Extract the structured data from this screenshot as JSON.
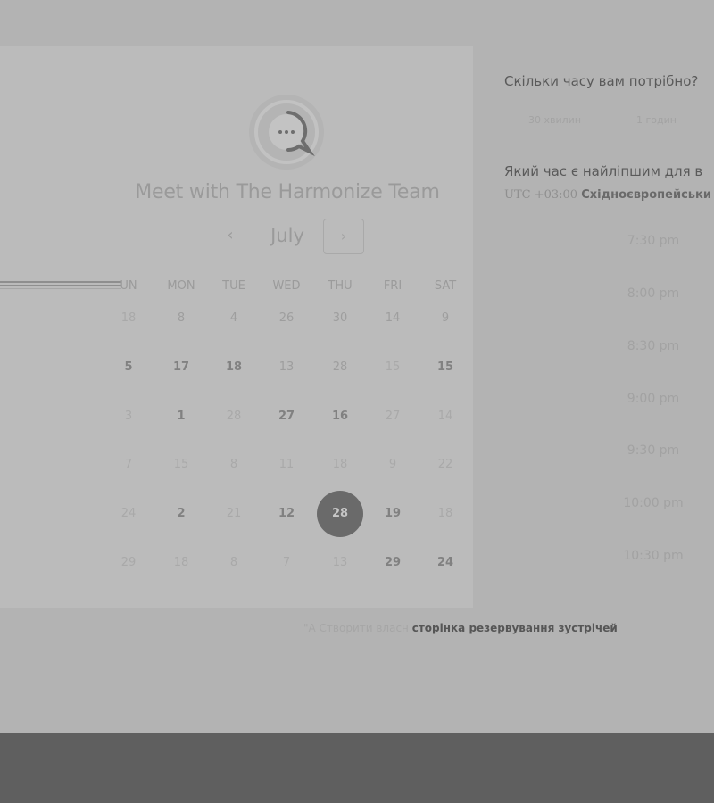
{
  "card": {
    "title": "Meet with The Harmonize Team",
    "month": "July",
    "prev_icon": "‹",
    "next_icon": "›",
    "logo_icon": "chat-bubble-icon",
    "weekdays": [
      "UN",
      "MON",
      "TUE",
      "WED",
      "THU",
      "FRI",
      "SAT"
    ],
    "rows": [
      [
        {
          "v": "18",
          "s": "faint"
        },
        {
          "v": "8",
          "s": "dim"
        },
        {
          "v": "4",
          "s": "dim"
        },
        {
          "v": "26",
          "s": "dim"
        },
        {
          "v": "30",
          "s": "dim"
        },
        {
          "v": "14",
          "s": "dim"
        },
        {
          "v": "9",
          "s": "dim"
        }
      ],
      [
        {
          "v": "5",
          "s": "bold"
        },
        {
          "v": "17",
          "s": "bold"
        },
        {
          "v": "18",
          "s": "bold"
        },
        {
          "v": "13",
          "s": "dim"
        },
        {
          "v": "28",
          "s": "dim"
        },
        {
          "v": "15",
          "s": "faint"
        },
        {
          "v": "15",
          "s": "bold"
        }
      ],
      [
        {
          "v": "3",
          "s": "faint"
        },
        {
          "v": "1",
          "s": "bold"
        },
        {
          "v": "28",
          "s": "faint"
        },
        {
          "v": "27",
          "s": "bold"
        },
        {
          "v": "16",
          "s": "bold"
        },
        {
          "v": "27",
          "s": "faint"
        },
        {
          "v": "14",
          "s": "faint"
        }
      ],
      [
        {
          "v": "7",
          "s": "faint"
        },
        {
          "v": "15",
          "s": "faint"
        },
        {
          "v": "8",
          "s": "faint"
        },
        {
          "v": "11",
          "s": "faint"
        },
        {
          "v": "18",
          "s": "faint"
        },
        {
          "v": "9",
          "s": "faint"
        },
        {
          "v": "22",
          "s": "faint"
        }
      ],
      [
        {
          "v": "24",
          "s": "faint"
        },
        {
          "v": "2",
          "s": "bold"
        },
        {
          "v": "21",
          "s": "faint"
        },
        {
          "v": "12",
          "s": "bold"
        },
        {
          "v": "28",
          "s": "selected"
        },
        {
          "v": "19",
          "s": "bold"
        },
        {
          "v": "18",
          "s": "faint"
        }
      ],
      [
        {
          "v": "29",
          "s": "faint"
        },
        {
          "v": "18",
          "s": "faint"
        },
        {
          "v": "8",
          "s": "faint"
        },
        {
          "v": "7",
          "s": "faint"
        },
        {
          "v": "13",
          "s": "faint"
        },
        {
          "v": "29",
          "s": "bold"
        },
        {
          "v": "24",
          "s": "bold"
        }
      ]
    ]
  },
  "booking": {
    "duration_question": "Скільки часу вам потрібно?",
    "durations": [
      "30 хвилин",
      "1 годин"
    ],
    "time_question": "Який час є найліпшим для в",
    "timezone_offset": "UTC +03:00",
    "timezone_name": "Східноєвропейськи",
    "slots": [
      "7:30 pm",
      "8:00 pm",
      "8:30 pm",
      "9:00 pm",
      "9:30 pm",
      "10:00 pm",
      "10:30 pm"
    ]
  },
  "footer": {
    "prefix": "\"A Створити власн",
    "link": "сторінка резервування зустрічей"
  },
  "colors": {
    "background": "#b3b3b3",
    "selected_day": "#6a6a6a",
    "bottom_bar": "#5f5f5f"
  }
}
